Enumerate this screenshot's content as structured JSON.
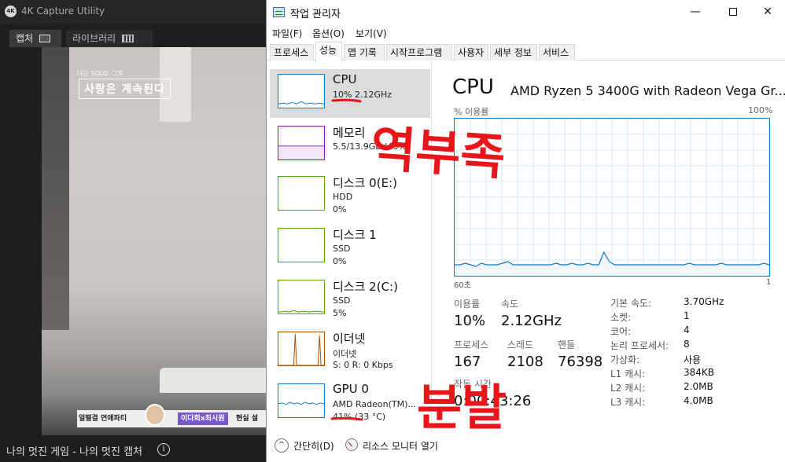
{
  "capture": {
    "logo_text": "4K",
    "app_title": "4K Capture Utility",
    "tabs": [
      {
        "label": "캡처",
        "icon": "screen-icon"
      },
      {
        "label": "라이브러리",
        "icon": "grid-icon"
      }
    ],
    "video": {
      "caption_small": "나는 SOLO, 그후",
      "caption_main": "사랑은 계속된다",
      "banner_left": "얼떨결 연애파티",
      "banner_tag": "이다희x최시원",
      "banner_right": "현실 설"
    },
    "status_text": "나의 멋진 게임 - 나의 멋진 캡처"
  },
  "taskmgr": {
    "title": "작업 관리자",
    "window_buttons": {
      "minimize": "—",
      "maximize": "",
      "close": "✕"
    },
    "menu": [
      "파일(F)",
      "옵션(O)",
      "보기(V)"
    ],
    "tabs": [
      "프로세스",
      "성능",
      "앱 기록",
      "시작프로그램",
      "사용자",
      "세부 정보",
      "서비스"
    ],
    "active_tab": "성능",
    "sidebar": [
      {
        "title": "CPU",
        "line1": "10% 2.12GHz",
        "line2": "",
        "color": "#1178c6",
        "selected": true
      },
      {
        "title": "메모리",
        "line1": "5.5/13.9GB (40%)",
        "line2": "",
        "color": "#8b12ae",
        "selected": false
      },
      {
        "title": "디스크 0(E:)",
        "line1": "HDD",
        "line2": "0%",
        "color": "#4da60c",
        "selected": false
      },
      {
        "title": "디스크 1",
        "line1": "SSD",
        "line2": "0%",
        "color": "#4da60c",
        "selected": false
      },
      {
        "title": "디스크 2(C:)",
        "line1": "SSD",
        "line2": "5%",
        "color": "#4da60c",
        "selected": false
      },
      {
        "title": "이더넷",
        "line1": "이더넷",
        "line2": "S: 0 R: 0 Kbps",
        "color": "#a74f01",
        "selected": false
      },
      {
        "title": "GPU 0",
        "line1": "AMD Radeon(TM)...",
        "line2": "41% (33 °C)",
        "color": "#1178c6",
        "selected": false
      }
    ],
    "main": {
      "title": "CPU",
      "subtitle": "AMD Ryzen 5 3400G with Radeon Vega Gr...",
      "graph_ylabel": "% 이용률",
      "graph_ymax": "100%",
      "graph_xleft": "60초",
      "graph_xright": "1",
      "stats": {
        "usage_label": "이용률",
        "usage_value": "10%",
        "speed_label": "속도",
        "speed_value": "2.12GHz",
        "proc_label": "프로세스",
        "proc_value": "167",
        "thread_label": "스레드",
        "thread_value": "2108",
        "handle_label": "핸들",
        "handle_value": "76398",
        "uptime_label": "작동 시간",
        "uptime_value": "0:00:43:26"
      },
      "details": [
        {
          "k": "기본 속도:",
          "v": "3.70GHz"
        },
        {
          "k": "소켓:",
          "v": "1"
        },
        {
          "k": "코어:",
          "v": "4"
        },
        {
          "k": "논리 프로세서:",
          "v": "8"
        },
        {
          "k": "가상화:",
          "v": "사용"
        },
        {
          "k": "L1 캐시:",
          "v": "384KB"
        },
        {
          "k": "L2 캐시:",
          "v": "2.0MB"
        },
        {
          "k": "L3 캐시:",
          "v": "4.0MB"
        }
      ],
      "cpu_history_percent": [
        7,
        7,
        8,
        7,
        6,
        8,
        7,
        7,
        7,
        8,
        9,
        7,
        7,
        7,
        7,
        7,
        7,
        7,
        7,
        8,
        7,
        7,
        8,
        7,
        7,
        8,
        7,
        7,
        15,
        9,
        7,
        7,
        7,
        7,
        7,
        7,
        7,
        7,
        7,
        7,
        7,
        7,
        7,
        7,
        8,
        7,
        7,
        7,
        7,
        7,
        8,
        7,
        7,
        7,
        7,
        7,
        7,
        7,
        8,
        7
      ]
    },
    "footer": {
      "fewer_details": "간단히(D)",
      "resource_monitor": "리소스 모니터 열기"
    }
  },
  "annotations": {
    "note1": "역부족",
    "note2": "분발",
    "color": "#e8151b"
  }
}
